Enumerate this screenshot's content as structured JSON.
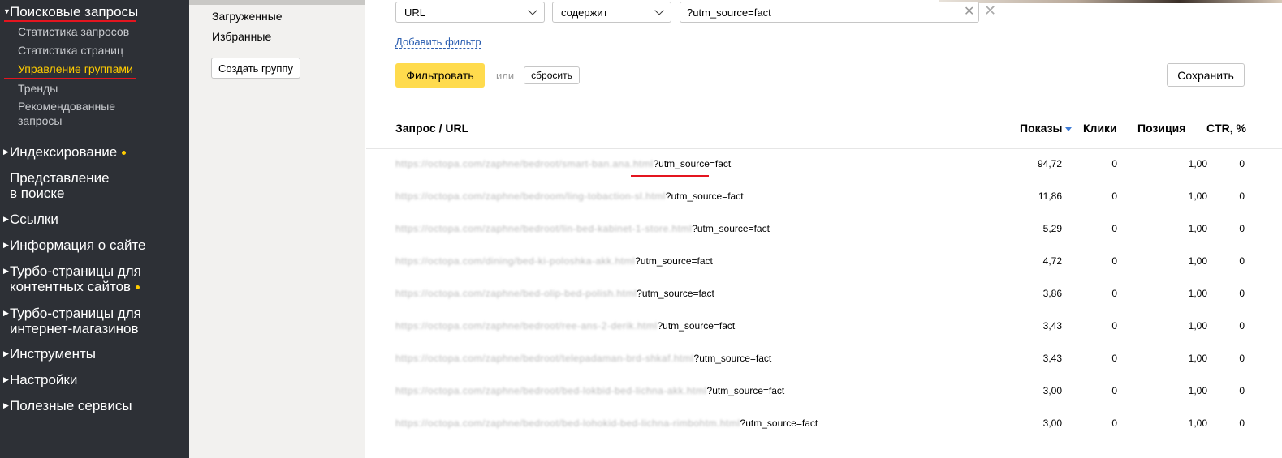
{
  "sidebar": {
    "sections": [
      {
        "label": "Поисковые запросы",
        "expanded": true
      },
      {
        "label": "Индексирование",
        "dot": true
      },
      {
        "label_line1": "Представление",
        "label_line2": "в поиске"
      },
      {
        "label": "Ссылки"
      },
      {
        "label": "Информация о сайте"
      },
      {
        "label_line1": "Турбо-страницы для",
        "label_line2": "контентных сайтов",
        "dot": true
      },
      {
        "label_line1": "Турбо-страницы для",
        "label_line2": "интернет-магазинов"
      },
      {
        "label": "Инструменты"
      },
      {
        "label": "Настройки"
      },
      {
        "label": "Полезные сервисы"
      }
    ],
    "subitems": [
      {
        "label": "Статистика запросов"
      },
      {
        "label": "Статистика страниц"
      },
      {
        "label": "Управление группами",
        "active": true
      },
      {
        "label": "Тренды"
      },
      {
        "label_line1": "Рекомендованные",
        "label_line2": "запросы"
      }
    ],
    "accent_color": "#ffcc00"
  },
  "groups": {
    "items": [
      "Загруженные",
      "Избранные"
    ],
    "create_button": "Создать группу"
  },
  "filters": {
    "field_select": "URL",
    "condition_select": "содержит",
    "value": "?utm_source=fact",
    "add_filter_link": "Добавить фильтр",
    "filter_button": "Фильтровать",
    "or_label": "или",
    "reset_button": "сбросить",
    "save_button": "Сохранить"
  },
  "table": {
    "headers": {
      "query": "Запрос / URL",
      "shows": "Показы",
      "clicks": "Клики",
      "position": "Позиция",
      "ctr": "CTR, %"
    },
    "rows": [
      {
        "url_hidden": "https://octopa.com/zaphne/bedroot/smart-ban.ana.html",
        "url_visible": "?utm_source=fact",
        "shows": "94,72",
        "clicks": "0",
        "position": "1,00",
        "ctr": "0"
      },
      {
        "url_hidden": "https://octopa.com/zaphne/bedroom/ling-tobaction-sl.html",
        "url_visible": "?utm_source=fact",
        "shows": "11,86",
        "clicks": "0",
        "position": "1,00",
        "ctr": "0"
      },
      {
        "url_hidden": "https://octopa.com/zaphne/bedroot/lin-bed-kabinet-1-store.html",
        "url_visible": "?utm_source=fact",
        "shows": "5,29",
        "clicks": "0",
        "position": "1,00",
        "ctr": "0"
      },
      {
        "url_hidden": "https://octopa.com/dining/bed-ki-poloshka-akk.html",
        "url_visible": "?utm_source=fact",
        "shows": "4,72",
        "clicks": "0",
        "position": "1,00",
        "ctr": "0"
      },
      {
        "url_hidden": "https://octopa.com/zaphne/bed-olip-bed-polish.html",
        "url_visible": "?utm_source=fact",
        "shows": "3,86",
        "clicks": "0",
        "position": "1,00",
        "ctr": "0"
      },
      {
        "url_hidden": "https://octopa.com/zaphne/bedroot/ree-ans-2-derik.html",
        "url_visible": "?utm_source=fact",
        "shows": "3,43",
        "clicks": "0",
        "position": "1,00",
        "ctr": "0"
      },
      {
        "url_hidden": "https://octopa.com/zaphne/bedroot/telepadaman-brd-shkaf.html",
        "url_visible": "?utm_source=fact",
        "shows": "3,43",
        "clicks": "0",
        "position": "1,00",
        "ctr": "0"
      },
      {
        "url_hidden": "https://octopa.com/zaphne/bedroot/bed-lokbid-bed-lichna-akk.html",
        "url_visible": "?utm_source=fact",
        "shows": "3,00",
        "clicks": "0",
        "position": "1,00",
        "ctr": "0"
      },
      {
        "url_hidden": "https://octopa.com/zaphne/bedroot/bed-lohokid-bed-lichna-rimbohtm.html",
        "url_visible": "?utm_source=fact",
        "shows": "3,00",
        "clicks": "0",
        "position": "1,00",
        "ctr": "0"
      }
    ]
  },
  "annotation_color": "#e4151f"
}
